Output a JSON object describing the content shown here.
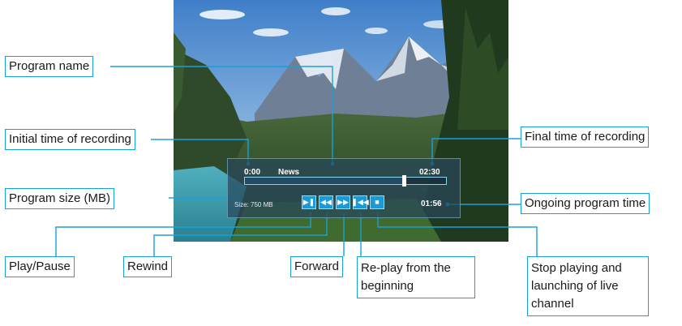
{
  "callouts": {
    "program_name": "Program name",
    "initial_time": "Initial time of recording",
    "program_size": "Program size (MB)",
    "final_time": "Final time of recording",
    "ongoing_time": "Ongoing program time",
    "play_pause": "Play/Pause",
    "rewind": "Rewind",
    "forward": "Forward",
    "replay": "Re-play from the beginning",
    "stop": "Stop playing and launching of live channel"
  },
  "player": {
    "start_time": "0:00",
    "program_name": "News",
    "end_time": "02:30",
    "size": "Size: 750 MB",
    "current_time": "01:56",
    "progress": 0.79
  },
  "icons": {
    "play_pause": "play-pause-icon",
    "rewind": "rewind-icon",
    "forward": "forward-icon",
    "replay": "skip-to-start-icon",
    "stop": "stop-icon"
  },
  "colors": {
    "accent": "#1aa0d8",
    "button": "#1c9ad6"
  }
}
